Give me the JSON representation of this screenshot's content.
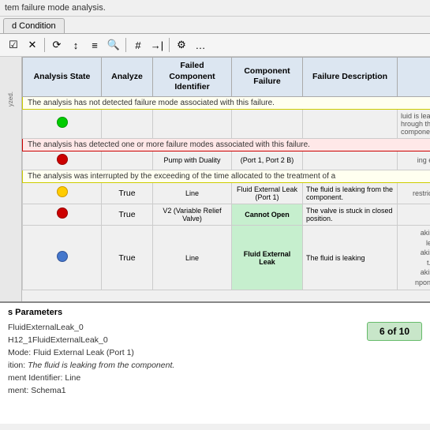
{
  "topbar": {
    "text": "tem failure mode analysis."
  },
  "tab": {
    "label": "d Condition"
  },
  "toolbar": {
    "icons": [
      "✓",
      "✕",
      "⟳",
      "↕",
      "≡",
      "≡",
      "⚓",
      "#",
      "→|",
      "☰",
      "⚙",
      "…"
    ]
  },
  "table": {
    "headers": [
      "Analysis State",
      "Analyze",
      "Failed Component Identifier",
      "Component Failure",
      "Failure Description"
    ],
    "rows": [
      {
        "state_color": "green",
        "analyze": "",
        "failed_comp": "",
        "comp_failure": "",
        "failure_desc": "",
        "tooltip": "The analysis has not detected failure mode associated with this failure.",
        "tooltip_type": "yellow",
        "extra": "luid is leaking hrough the component."
      },
      {
        "state_color": "red",
        "analyze": "",
        "failed_comp": "Pump with Duality",
        "comp_failure": "(Port 1, Port 2 B)",
        "failure_desc": "",
        "tooltip": "The analysis has detected one or more failure modes associated with this failure.",
        "tooltip_type": "red",
        "extra": "ing ent."
      },
      {
        "state_color": "red",
        "analyze": "True",
        "failed_comp": "Line",
        "comp_failure": "Fluid External Leak (Port 1)",
        "failure_desc": "The fluid is leaking from the component.",
        "tooltip": "The analysis was interrupted by the exceeding of the time allocated to the treatment of a",
        "tooltip_type": "yellow",
        "extra": "restrictive."
      },
      {
        "state_color": "yellow",
        "analyze": "",
        "failed_comp": "",
        "comp_failure": "",
        "failure_desc": "",
        "tooltip": "",
        "tooltip_type": "",
        "extra": ""
      },
      {
        "state_color": "red",
        "analyze": "True",
        "failed_comp": "V2 (Variable Relief Valve)",
        "comp_failure": "Cannot Open",
        "failure_desc": "The valve is stuck in closed position.",
        "tooltip": "",
        "tooltip_type": "",
        "extra": ""
      },
      {
        "state_color": "blue",
        "analyze": "True",
        "failed_comp": "Line",
        "comp_failure": "Fluid External Leak",
        "failure_desc": "The fluid is leaking",
        "tooltip": "",
        "tooltip_type": "",
        "extra": "aking le aking t. aking nponent."
      }
    ]
  },
  "bottom": {
    "title": "s Parameters",
    "items": [
      {
        "label": "",
        "value": "FluidExternalLeak_0"
      },
      {
        "label": "",
        "value": "H12_1FluidExternalLeak_0"
      },
      {
        "label": "Mode:",
        "value": "Fluid External Leak (Port 1)"
      },
      {
        "label": "ition:",
        "value": "The fluid is leaking from the component."
      },
      {
        "label": "ment Identifier:",
        "value": "Line"
      },
      {
        "label": "ment:",
        "value": "Schema1"
      }
    ],
    "page": "6 of 10"
  },
  "highlighted_cell": {
    "text": "Cannot Open Fluid External Leak",
    "note": "shown highlighted in table"
  }
}
